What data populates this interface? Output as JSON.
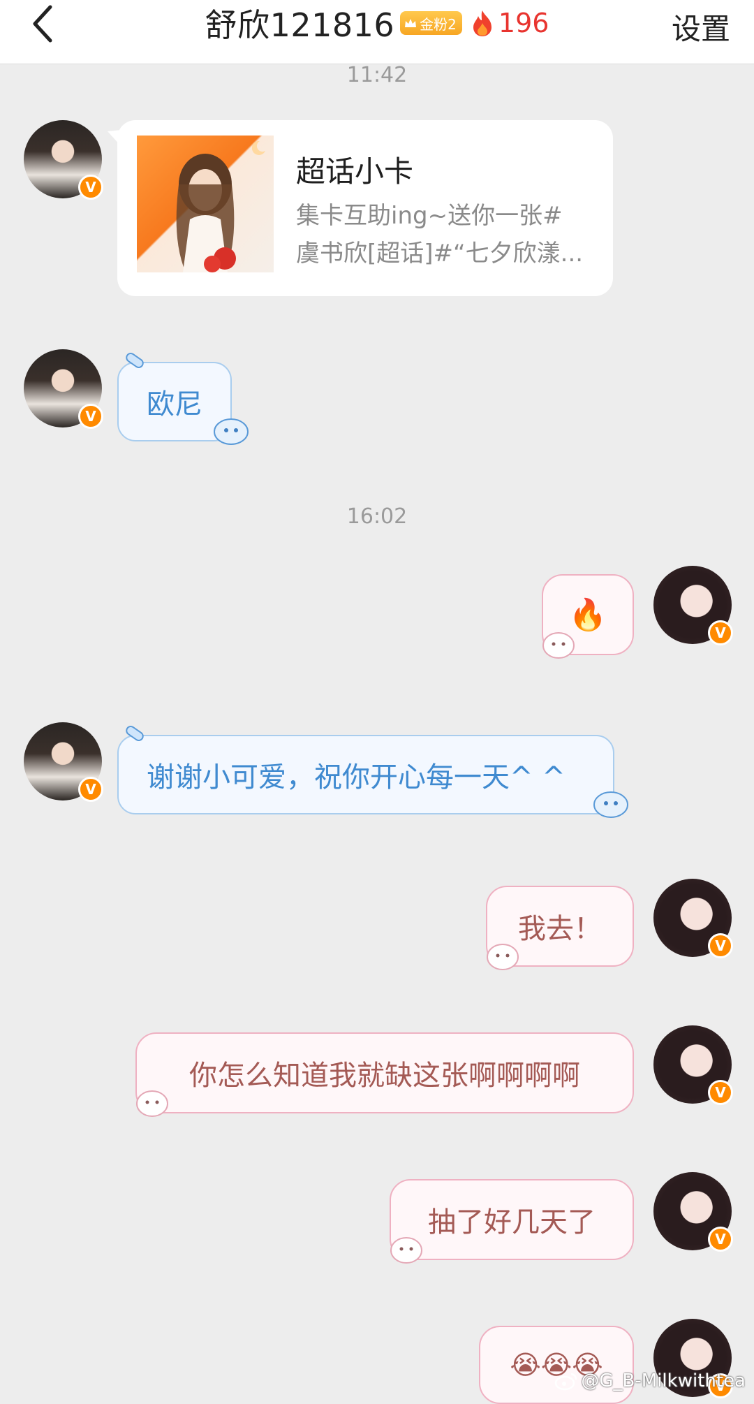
{
  "header": {
    "title": "舒欣121816",
    "fan_badge": "金粉2",
    "flame_count": "196",
    "settings_label": "设置",
    "back_icon": "chevron-left-icon"
  },
  "times": [
    "11:42",
    "16:02"
  ],
  "card": {
    "title": "超话小卡",
    "desc_line1": "集卡互助ing~送你一张#",
    "desc_line2": "虞书欣[超话]#“七夕欣漾..."
  },
  "messages": [
    {
      "side": "left",
      "text": "欧尼"
    },
    {
      "side": "right",
      "text": "🔥"
    },
    {
      "side": "left",
      "text": "谢谢小可爱，祝你开心每一天^ ^"
    },
    {
      "side": "right",
      "text": "我去！"
    },
    {
      "side": "right",
      "text": "你怎么知道我就缺这张啊啊啊啊"
    },
    {
      "side": "right",
      "text": "抽了好几天了"
    },
    {
      "side": "right",
      "text": "😭😭😭"
    }
  ],
  "watermark": "@G_B-Milkwithtea",
  "colors": {
    "flame": "#e8342f",
    "blue_bubble_border": "#a9cdee",
    "pink_bubble_border": "#efb1c2",
    "verified_badge": "#ff8a00"
  }
}
